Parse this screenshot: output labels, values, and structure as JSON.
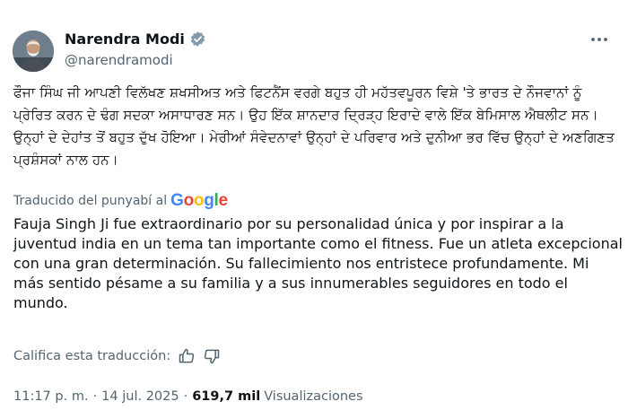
{
  "author": {
    "name": "Narendra Modi",
    "handle": "@narendramodi",
    "verified_color": "#829aab"
  },
  "tweet": {
    "original_text": "ਫੌਜਾ ਸਿੰਘ ਜੀ ਆਪਣੀ ਵਿਲੱਖਣ ਸ਼ਖਸੀਅਤ ਅਤੇ ਫਿਟਨੈਂਸ ਵਰਗੇ ਬਹੁਤ ਹੀ ਮਹੱਤਵਪੂਰਨ ਵਿਸ਼ੇ 'ਤੇ ਭਾਰਤ ਦੇ ਨੌਜਵਾਨਾਂ ਨੂੰ ਪ੍ਰੇਰਿਤ ਕਰਨ ਦੇ ਢੰਗ ਸਦਕਾ ਅਸਾਧਾਰਣ ਸਨ। ਉਹ ਇੱਕ ਸ਼ਾਨਦਾਰ ਦ੍ਰਿੜ੍ਹ ਇਰਾਦੇ ਵਾਲੇ ਇੱਕ ਬੇਮਿਸਾਲ ਐਥਲੀਟ ਸਨ। ਉਨ੍ਹਾਂ ਦੇ ਦੇਹਾਂਤ ਤੋਂ ਬਹੁਤ ਦੁੱਖ ਹੋਇਆ। ਮੇਰੀਆਂ ਸੰਵੇਦਨਾਵਾਂ ਉਨ੍ਹਾਂ ਦੇ ਪਰਿਵਾਰ ਅਤੇ ਦੁਨੀਆ ਭਰ ਵਿੱਚ ਉਨ੍ਹਾਂ ਦੇ ਅਣਗਿਣਤ ਪ੍ਰਸ਼ੰਸਕਾਂ ਨਾਲ ਹਨ।",
    "translated_by_label": "Traducido del punyabí al",
    "translator_brand": "Google",
    "translated_text": "Fauja Singh Ji fue extraordinario por su personalidad única y por inspirar a la juventud india en un tema tan importante como el fitness. Fue un atleta excepcional con una gran determinación. Su fallecimiento nos entristece profundamente. Mi más sentido pésame a su familia y a sus innumerables seguidores en todo el mundo.",
    "rate_label": "Califica esta traducción:",
    "time": "11:17 p. m.",
    "date": "14 jul. 2025",
    "views_count": "619,7 mil",
    "views_label": "Visualizaciones"
  },
  "icons": {
    "verified": "verified-badge-icon",
    "more": "more-options-icon",
    "thumbs_up": "thumbs-up-icon",
    "thumbs_down": "thumbs-down-icon"
  }
}
